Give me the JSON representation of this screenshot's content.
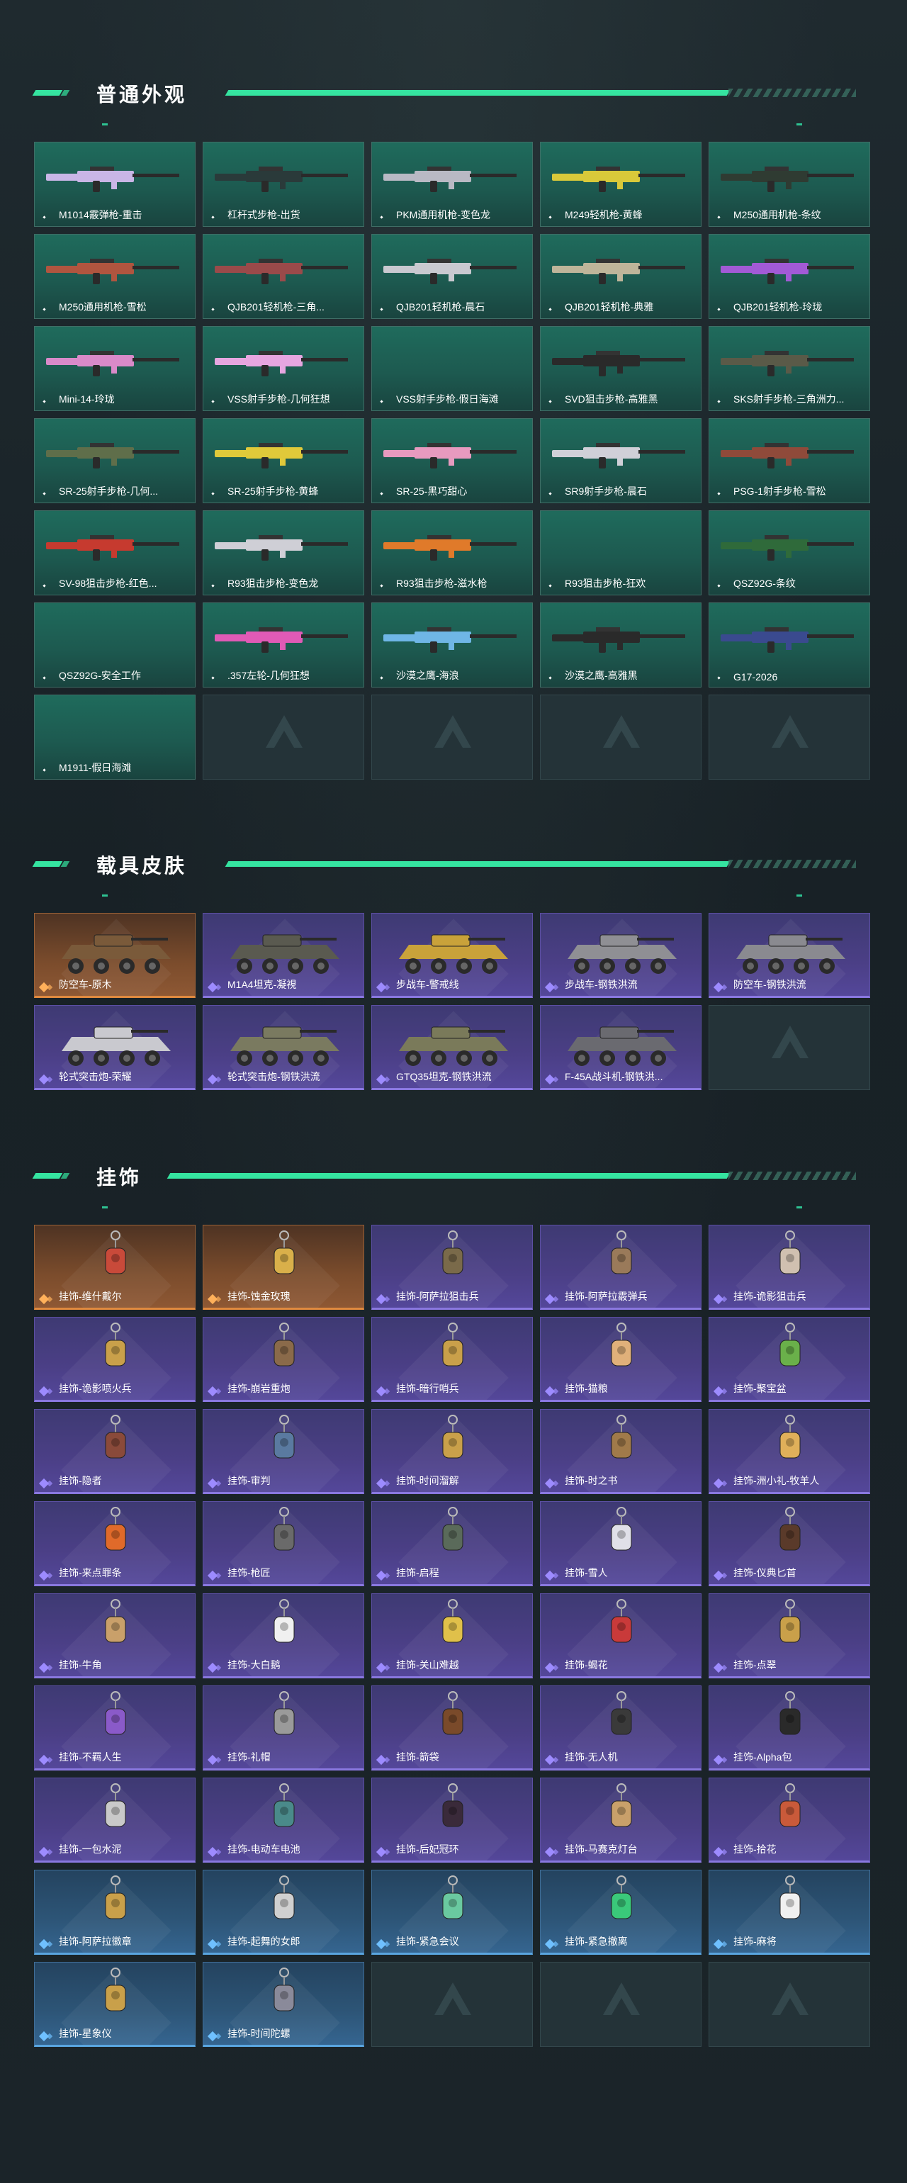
{
  "sections": {
    "skins": {
      "title": "普通外观",
      "items": [
        {
          "label": "M1014霰弹枪-重击",
          "color": "#c9b6e6"
        },
        {
          "label": "杠杆式步枪-出货",
          "color": "#2a3a3a"
        },
        {
          "label": "PKM通用机枪-变色龙",
          "color": "#b9b9c4"
        },
        {
          "label": "M249轻机枪-黄蜂",
          "color": "#d9c93a"
        },
        {
          "label": "M250通用机枪-条纹",
          "color": "#2f3b32"
        },
        {
          "label": "M250通用机枪-雪松",
          "color": "#b0553f"
        },
        {
          "label": "QJB201轻机枪-三角...",
          "color": "#9a4a4a"
        },
        {
          "label": "QJB201轻机枪-晨石",
          "color": "#c9c9d0"
        },
        {
          "label": "QJB201轻机枪-典雅",
          "color": "#bfb59a"
        },
        {
          "label": "QJB201轻机枪-玲珑",
          "color": "#a25ad6"
        },
        {
          "label": "Mini-14-玲珑",
          "color": "#d98ac9"
        },
        {
          "label": "VSS射手步枪-几何狂想",
          "color": "#e6a6e0"
        },
        {
          "label": "VSS射手步枪-假日海滩",
          "color": ""
        },
        {
          "label": "SVD狙击步枪-高雅黑",
          "color": "#2a2a2a"
        },
        {
          "label": "SKS射手步枪-三角洲力...",
          "color": "#5a5a48"
        },
        {
          "label": "SR-25射手步枪-几何...",
          "color": "#5f6e4a"
        },
        {
          "label": "SR-25射手步枪-黄蜂",
          "color": "#e0c93a"
        },
        {
          "label": "SR-25-黑巧甜心",
          "color": "#e79abf"
        },
        {
          "label": "SR9射手步枪-晨石",
          "color": "#d0d0d8"
        },
        {
          "label": "PSG-1射手步枪-雪松",
          "color": "#8f4a3a"
        },
        {
          "label": "SV-98狙击步枪-红色...",
          "color": "#c63a2f"
        },
        {
          "label": "R93狙击步枪-变色龙",
          "color": "#cfcfd6"
        },
        {
          "label": "R93狙击步枪-滋水枪",
          "color": "#e07a2a"
        },
        {
          "label": "R93狙击步枪-狂欢",
          "color": ""
        },
        {
          "label": "QSZ92G-条纹",
          "color": "#2f6a3a"
        },
        {
          "label": "QSZ92G-安全工作",
          "color": ""
        },
        {
          "label": ".357左轮-几何狂想",
          "color": "#e05ab6"
        },
        {
          "label": "沙漠之鹰-海浪",
          "color": "#6fb6e6"
        },
        {
          "label": "沙漠之鹰-高雅黑",
          "color": "#2a2a2a"
        },
        {
          "label": "G17-2026",
          "color": "#3a4a8f"
        },
        {
          "label": "M1911-假日海滩",
          "color": ""
        }
      ]
    },
    "vehicles": {
      "title": "载具皮肤",
      "items": [
        {
          "label": "防空车-原木",
          "rarity": "orange",
          "color": "#7a5a3a"
        },
        {
          "label": "M1A4坦克-凝視",
          "rarity": "purple",
          "color": "#5a5a50"
        },
        {
          "label": "步战车-警戒线",
          "rarity": "purple",
          "color": "#c9a23a"
        },
        {
          "label": "步战车-钢铁洪流",
          "rarity": "purple",
          "color": "#8f8f94"
        },
        {
          "label": "防空车-钢铁洪流",
          "rarity": "purple",
          "color": "#8a8a90"
        },
        {
          "label": "轮式突击炮-荣耀",
          "rarity": "purple",
          "color": "#c9c9cf"
        },
        {
          "label": "轮式突击炮-钢铁洪流",
          "rarity": "purple",
          "color": "#7a7a60"
        },
        {
          "label": "GTQ35坦克-钢铁洪流",
          "rarity": "purple",
          "color": "#7a7a5a"
        },
        {
          "label": "F-45A战斗机-钢铁洪...",
          "rarity": "purple",
          "color": "#6a6a70"
        }
      ]
    },
    "charms": {
      "title": "挂饰",
      "items": [
        {
          "label": "挂饰-维什戴尔",
          "rarity": "orange",
          "color": "#c94a3a"
        },
        {
          "label": "挂饰-蚀金玫瑰",
          "rarity": "orange",
          "color": "#d9b04a"
        },
        {
          "label": "挂饰-阿萨拉狙击兵",
          "rarity": "purple",
          "color": "#7a6a4a"
        },
        {
          "label": "挂饰-阿萨拉霰弹兵",
          "rarity": "purple",
          "color": "#9a7a5a"
        },
        {
          "label": "挂饰-诡影狙击兵",
          "rarity": "purple",
          "color": "#d0c0b0"
        },
        {
          "label": "挂饰-诡影喷火兵",
          "rarity": "purple",
          "color": "#c9a04a"
        },
        {
          "label": "挂饰-崩岩重炮",
          "rarity": "purple",
          "color": "#8a6a4a"
        },
        {
          "label": "挂饰-暗行哨兵",
          "rarity": "purple",
          "color": "#c9a04a"
        },
        {
          "label": "挂饰-猫粮",
          "rarity": "purple",
          "color": "#e0b07a"
        },
        {
          "label": "挂饰-聚宝盆",
          "rarity": "purple",
          "color": "#6ab04a"
        },
        {
          "label": "挂饰-隐者",
          "rarity": "purple",
          "color": "#8a4a3a"
        },
        {
          "label": "挂饰-审判",
          "rarity": "purple",
          "color": "#5a7aa0"
        },
        {
          "label": "挂饰-时间溜解",
          "rarity": "purple",
          "color": "#c9a04a"
        },
        {
          "label": "挂饰-时之书",
          "rarity": "purple",
          "color": "#a07a4a"
        },
        {
          "label": "挂饰-洲小礼-牧羊人",
          "rarity": "purple",
          "color": "#e0b05a"
        },
        {
          "label": "挂饰-来点罪条",
          "rarity": "purple",
          "color": "#e06a2a"
        },
        {
          "label": "挂饰-枪匠",
          "rarity": "purple",
          "color": "#6a6a6a"
        },
        {
          "label": "挂饰-启程",
          "rarity": "purple",
          "color": "#5a6a5a"
        },
        {
          "label": "挂饰-雪人",
          "rarity": "purple",
          "color": "#e0e0e8"
        },
        {
          "label": "挂饰-仪典匕首",
          "rarity": "purple",
          "color": "#5a3a2a"
        },
        {
          "label": "挂饰-牛角",
          "rarity": "purple",
          "color": "#c9a06a"
        },
        {
          "label": "挂饰-大白鹅",
          "rarity": "purple",
          "color": "#f0f0f0"
        },
        {
          "label": "挂饰-关山难越",
          "rarity": "purple",
          "color": "#e0c04a"
        },
        {
          "label": "挂饰-蝎花",
          "rarity": "purple",
          "color": "#c93a3a"
        },
        {
          "label": "挂饰-点翠",
          "rarity": "purple",
          "color": "#c9a04a"
        },
        {
          "label": "挂饰-不羁人生",
          "rarity": "purple",
          "color": "#8a5ac9"
        },
        {
          "label": "挂饰-礼帽",
          "rarity": "purple",
          "color": "#9a9a9a"
        },
        {
          "label": "挂饰-箭袋",
          "rarity": "purple",
          "color": "#7a4a2a"
        },
        {
          "label": "挂饰-无人机",
          "rarity": "purple",
          "color": "#3a3a3a"
        },
        {
          "label": "挂饰-Alpha包",
          "rarity": "purple",
          "color": "#2a2a2a"
        },
        {
          "label": "挂饰-一包水泥",
          "rarity": "purple",
          "color": "#c9c9c9"
        },
        {
          "label": "挂饰-电动车电池",
          "rarity": "purple",
          "color": "#4a8a8a"
        },
        {
          "label": "挂饰-后妃冠环",
          "rarity": "purple",
          "color": "#3a2a3a"
        },
        {
          "label": "挂饰-马赛克灯台",
          "rarity": "purple",
          "color": "#c9a06a"
        },
        {
          "label": "挂饰-拾花",
          "rarity": "purple",
          "color": "#c95a3a"
        },
        {
          "label": "挂饰-阿萨拉徽章",
          "rarity": "blue",
          "color": "#c9a04a"
        },
        {
          "label": "挂饰-起舞的女郎",
          "rarity": "blue",
          "color": "#d0d0d0"
        },
        {
          "label": "挂饰-紧急会议",
          "rarity": "blue",
          "color": "#6ac9a0"
        },
        {
          "label": "挂饰-紧急撤离",
          "rarity": "blue",
          "color": "#3ac97a"
        },
        {
          "label": "挂饰-麻将",
          "rarity": "blue",
          "color": "#f0f0f0"
        },
        {
          "label": "挂饰-星象仪",
          "rarity": "blue",
          "color": "#c9a04a"
        },
        {
          "label": "挂饰-时间陀螺",
          "rarity": "blue",
          "color": "#8a8a9a"
        }
      ]
    }
  }
}
